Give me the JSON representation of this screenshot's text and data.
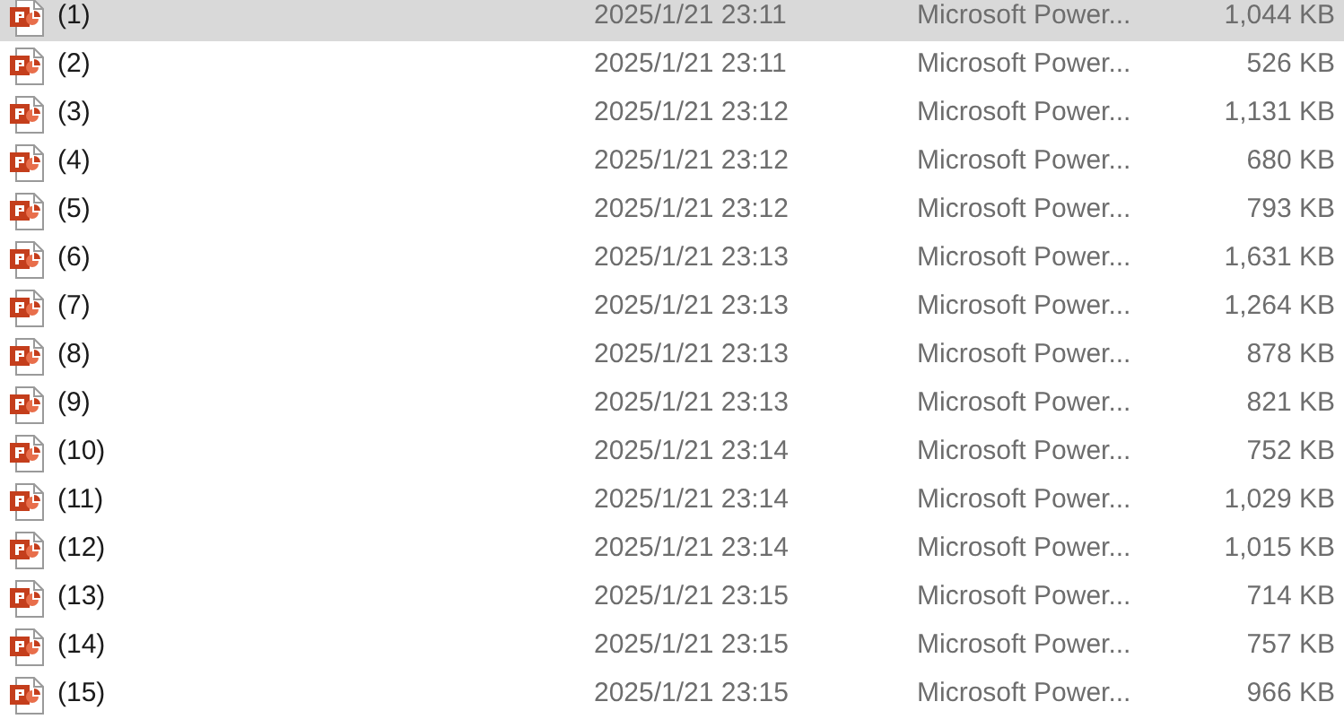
{
  "files": [
    {
      "name": "(1)",
      "modified": "2025/1/21 23:11",
      "type": "Microsoft Power...",
      "size": "1,044 KB",
      "selected": true
    },
    {
      "name": "(2)",
      "modified": "2025/1/21 23:11",
      "type": "Microsoft Power...",
      "size": "526 KB",
      "selected": false
    },
    {
      "name": "(3)",
      "modified": "2025/1/21 23:12",
      "type": "Microsoft Power...",
      "size": "1,131 KB",
      "selected": false
    },
    {
      "name": "(4)",
      "modified": "2025/1/21 23:12",
      "type": "Microsoft Power...",
      "size": "680 KB",
      "selected": false
    },
    {
      "name": "(5)",
      "modified": "2025/1/21 23:12",
      "type": "Microsoft Power...",
      "size": "793 KB",
      "selected": false
    },
    {
      "name": "(6)",
      "modified": "2025/1/21 23:13",
      "type": "Microsoft Power...",
      "size": "1,631 KB",
      "selected": false
    },
    {
      "name": "(7)",
      "modified": "2025/1/21 23:13",
      "type": "Microsoft Power...",
      "size": "1,264 KB",
      "selected": false
    },
    {
      "name": "(8)",
      "modified": "2025/1/21 23:13",
      "type": "Microsoft Power...",
      "size": "878 KB",
      "selected": false
    },
    {
      "name": "(9)",
      "modified": "2025/1/21 23:13",
      "type": "Microsoft Power...",
      "size": "821 KB",
      "selected": false
    },
    {
      "name": "(10)",
      "modified": "2025/1/21 23:14",
      "type": "Microsoft Power...",
      "size": "752 KB",
      "selected": false
    },
    {
      "name": "(11)",
      "modified": "2025/1/21 23:14",
      "type": "Microsoft Power...",
      "size": "1,029 KB",
      "selected": false
    },
    {
      "name": "(12)",
      "modified": "2025/1/21 23:14",
      "type": "Microsoft Power...",
      "size": "1,015 KB",
      "selected": false
    },
    {
      "name": "(13)",
      "modified": "2025/1/21 23:15",
      "type": "Microsoft Power...",
      "size": "714 KB",
      "selected": false
    },
    {
      "name": "(14)",
      "modified": "2025/1/21 23:15",
      "type": "Microsoft Power...",
      "size": "757 KB",
      "selected": false
    },
    {
      "name": "(15)",
      "modified": "2025/1/21 23:15",
      "type": "Microsoft Power...",
      "size": "966 KB",
      "selected": false
    }
  ]
}
